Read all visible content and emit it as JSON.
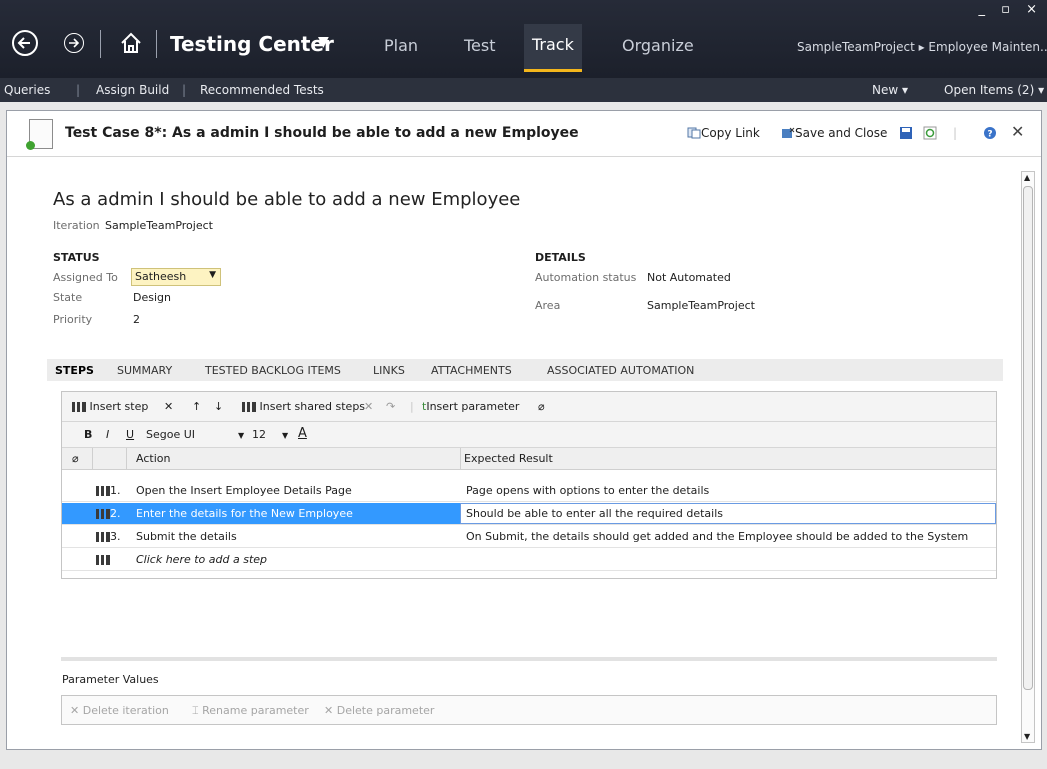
{
  "nav": {
    "back_icon": "back-arrow-circle",
    "forward_icon": "forward-arrow-circle",
    "app_title": "Testing Center",
    "tabs": [
      {
        "label": "Plan",
        "active": false
      },
      {
        "label": "Test",
        "active": false
      },
      {
        "label": "Track",
        "active": true
      },
      {
        "label": "Organize",
        "active": false
      }
    ],
    "breadcrumb": "SampleTeamProject ▸ Employee Mainten...",
    "accent_color": "#f3b61c"
  },
  "subbar": {
    "queries": "Queries",
    "assign_build": "Assign Build",
    "recommended_tests": "Recommended Tests",
    "new": "New",
    "open_items": "Open Items (2)"
  },
  "panel": {
    "title": "Test Case 8*: As a admin I should be able to add a new Employee",
    "copy_link": "Copy Link",
    "save_close": "Save and Close"
  },
  "workitem": {
    "title": "As a admin I should be able to add a new Employee",
    "iteration_label": "Iteration",
    "iteration_value": "SampleTeamProject",
    "status_heading": "STATUS",
    "assigned_to_label": "Assigned To",
    "assigned_to_value": "Satheesh",
    "state_label": "State",
    "state_value": "Design",
    "priority_label": "Priority",
    "priority_value": "2",
    "details_heading": "DETAILS",
    "automation_label": "Automation status",
    "automation_value": "Not Automated",
    "area_label": "Area",
    "area_value": "SampleTeamProject"
  },
  "tabs": [
    {
      "label": "STEPS",
      "active": true
    },
    {
      "label": "SUMMARY",
      "active": false
    },
    {
      "label": "TESTED BACKLOG ITEMS",
      "active": false
    },
    {
      "label": "LINKS",
      "active": false
    },
    {
      "label": "ATTACHMENTS",
      "active": false
    },
    {
      "label": "ASSOCIATED AUTOMATION",
      "active": false
    }
  ],
  "steps_toolbar": {
    "insert_step": "Insert step",
    "insert_shared": "Insert shared steps",
    "insert_param": "Insert parameter",
    "font_name": "Segoe UI",
    "font_size": "12",
    "bold": "B",
    "italic": "I",
    "underline": "U",
    "font_color": "A"
  },
  "grid": {
    "headers": {
      "action": "Action",
      "expected": "Expected Result"
    },
    "rows": [
      {
        "num": "1.",
        "action": "Open the Insert Employee Details Page",
        "expected": "Page opens with options to enter the details"
      },
      {
        "num": "2.",
        "action": "Enter the details for the New Employee",
        "expected": "Should be able to enter all the required details",
        "selected": true
      },
      {
        "num": "3.",
        "action": "Submit the details",
        "expected": "On Submit, the details should get added and the Employee should be added to the System"
      }
    ],
    "add_step": "Click here to add a step"
  },
  "params": {
    "label": "Parameter Values",
    "delete_iteration": "Delete iteration",
    "rename_parameter": "Rename parameter",
    "delete_parameter": "Delete parameter"
  }
}
